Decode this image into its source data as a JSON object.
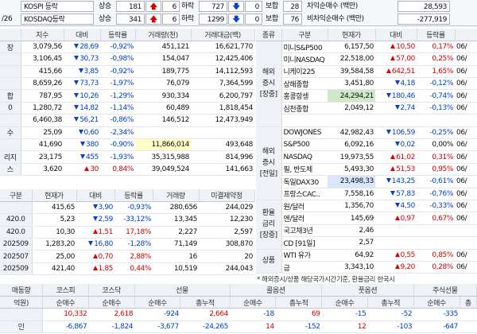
{
  "topbar": {
    "row1": {
      "date": "",
      "market": "KOSPI 등락",
      "rise_label": "상승",
      "rise_val": "181",
      "rise_chg": "6",
      "fall_label": "하락",
      "fall_val": "727",
      "fall_chg": "0",
      "flat_label": "보합",
      "flat_val": "28",
      "right_label": "차익순매수 (백만)",
      "right_val": "28,593"
    },
    "row2": {
      "date": "/26",
      "market": "KOSDAQ등락",
      "rise_label": "상승",
      "rise_val": "341",
      "rise_chg": "6",
      "fall_label": "하락",
      "fall_val": "1299",
      "fall_chg": "0",
      "flat_label": "보합",
      "flat_val": "76",
      "right_label": "비차익순매수 (백만)",
      "right_val": "-277,919"
    }
  },
  "left_table": {
    "headers": [
      "",
      "지수",
      "대비",
      "등락률",
      "거래량(천)",
      "거래대금(백)"
    ],
    "rows": [
      {
        "name": "장",
        "idx": "3,079,56",
        "dir": "dn",
        "chg": "28,69",
        "rate": "-0,92%",
        "vol": "451,121",
        "amt": "16,621,770"
      },
      {
        "name": "",
        "idx": "3,106,45",
        "dir": "dn",
        "chg": "30,73",
        "rate": "-0,98%",
        "vol": "154,047",
        "amt": "12,425,406"
      },
      {
        "name": "",
        "idx": "415,66",
        "dir": "dn",
        "chg": "3,85",
        "rate": "-0,92%",
        "vol": "189,775",
        "amt": "14,112,593"
      },
      {
        "name": "",
        "idx": "8,659,26",
        "dir": "dn",
        "chg": "73,73",
        "rate": "-1,97%",
        "vol": "76,079",
        "amt": "7,364,599"
      },
      {
        "name": "합",
        "idx": "787,95",
        "dir": "dn",
        "chg": "10,26",
        "rate": "-1,29%",
        "vol": "930,334",
        "amt": "6,200,797"
      },
      {
        "name": "0",
        "idx": "1,280,72",
        "dir": "dn",
        "chg": "14,82",
        "rate": "-1,14%",
        "vol": "60,489",
        "amt": "1,818,454"
      },
      {
        "name": "",
        "idx": "6,460,38",
        "dir": "dn",
        "chg": "56,21",
        "rate": "-0,86%",
        "vol": "146,512",
        "amt": "12,473,949"
      },
      {
        "name": "수",
        "idx": "25,09",
        "dir": "dn",
        "chg": "0,60",
        "rate": "-2,34%",
        "vol": "",
        "amt": ""
      },
      {
        "name": "",
        "idx": "41,690",
        "dir": "dn",
        "chg": "380",
        "rate": "-0,90%",
        "vol": "11,866,014",
        "amt": "493,648",
        "vol_hl": "y"
      },
      {
        "name": "리지",
        "idx": "23,175",
        "dir": "dn",
        "chg": "455",
        "rate": "-1,93%",
        "vol": "35,315,988",
        "amt": "814,996"
      },
      {
        "name": "스",
        "idx": "3,620",
        "dir": "up",
        "chg": "30",
        "rate": "0,84%",
        "vol": "39,049,524",
        "amt": "141,663"
      }
    ]
  },
  "futures_table": {
    "headers": [
      "구분",
      "현재가",
      "대비",
      "등락률",
      "거래량",
      "미결제약정"
    ],
    "rows": [
      {
        "name": "",
        "price": "415,65",
        "dir": "dn",
        "chg": "3,90",
        "rate": "-0,93%",
        "vol": "280,656",
        "oi": "244,029"
      },
      {
        "name": "420.0",
        "price": "5,23",
        "dir": "dn",
        "chg": "2,59",
        "rate": "-33,12%",
        "vol": "13,345",
        "oi": "12,230"
      },
      {
        "name": "420.0",
        "price": "10,30",
        "dir": "up",
        "chg": "1,51",
        "rate": "17,18%",
        "vol": "2,227",
        "oi": "2,597"
      },
      {
        "name": "202509",
        "price": "1,283,20",
        "dir": "dn",
        "chg": "16,80",
        "rate": "-1,28%",
        "vol": "71,149",
        "oi": "308,870"
      },
      {
        "name": "202507",
        "price": "25,00",
        "dir": "up",
        "chg": "0,70",
        "rate": "2,88%",
        "vol": "16",
        "oi": "20"
      },
      {
        "name": "202509",
        "price": "421,40",
        "dir": "up",
        "chg": "1,85",
        "rate": "0,44%",
        "vol": "10,519",
        "oi": "244,043"
      }
    ]
  },
  "right_table": {
    "headers": [
      "종류",
      "구분",
      "현재가",
      "대비",
      "등락률",
      ""
    ],
    "groups": [
      {
        "label": "해외\n증시\n[장중]",
        "span": 7
      },
      {
        "label": "해외\n증시\n[전일]",
        "span": 6
      },
      {
        "label": "환율\n금리\n[장중]",
        "span": 4
      },
      {
        "label": "상품",
        "span": 2
      }
    ],
    "rows": [
      {
        "name": "미니S&P500",
        "price": "6,157,50",
        "dir": "up",
        "chg": "10,50",
        "rate": "0,17%",
        "date": "06/"
      },
      {
        "name": "미니NASDAQ",
        "price": "22,518,00",
        "dir": "up",
        "chg": "57,00",
        "rate": "0,25%",
        "date": "06/"
      },
      {
        "name": "니케이225",
        "price": "39,584,58",
        "dir": "up",
        "chg": "642,51",
        "rate": "1,65%",
        "date": "06/"
      },
      {
        "name": "상해종합",
        "price": "3,451,80",
        "dir": "dn",
        "chg": "4,18",
        "rate": "-0,12%",
        "date": "06/"
      },
      {
        "name": "홍콩항셍",
        "price": "24,294,21",
        "dir": "dn",
        "chg": "180,46",
        "rate": "-0,74%",
        "date": "06/",
        "price_hl": "g"
      },
      {
        "name": "심천종합",
        "price": "2,049,12",
        "dir": "dn",
        "chg": "2,74",
        "rate": "-0,13%",
        "date": "06/"
      },
      {
        "name": "",
        "price": "",
        "dir": "",
        "chg": "",
        "rate": "",
        "date": ""
      },
      {
        "name": "DOWJONES",
        "price": "42,982,43",
        "dir": "dn",
        "chg": "106,59",
        "rate": "-0,25%",
        "date": "06/"
      },
      {
        "name": "S&P500",
        "price": "6,092,16",
        "dir": "dn",
        "chg": "0,02",
        "rate": "0,00%",
        "date": "06/"
      },
      {
        "name": "NASDAQ",
        "price": "19,973,55",
        "dir": "up",
        "chg": "61,02",
        "rate": "0,31%",
        "date": "06/"
      },
      {
        "name": "필, 반도체",
        "price": "5,493,30",
        "dir": "up",
        "chg": "51,53",
        "rate": "0,95%",
        "date": "06/"
      },
      {
        "name": "독일DAX30",
        "price": "23,498,33",
        "dir": "dn",
        "chg": "143,25",
        "rate": "-0,61%",
        "date": "06/",
        "price_hl": "b"
      },
      {
        "name": "프랑스CAC..",
        "price": "7,558,16",
        "dir": "dn",
        "chg": "57,83",
        "rate": "-0,76%",
        "date": "06/"
      },
      {
        "name": "원/달러",
        "price": "1,356,70",
        "dir": "dn",
        "chg": "4,50",
        "rate": "-0,33%",
        "date": "06/"
      },
      {
        "name": "엔/달러",
        "price": "145,69",
        "dir": "up",
        "chg": "0,97",
        "rate": "0,67%",
        "date": "06/"
      },
      {
        "name": "국고채3년",
        "price": "2,46",
        "dir": "",
        "chg": "",
        "rate": "",
        "date": ""
      },
      {
        "name": "CD [91일]",
        "price": "2,57",
        "dir": "",
        "chg": "",
        "rate": "",
        "date": ""
      },
      {
        "name": "WTI 유가",
        "price": "64,92",
        "dir": "up",
        "chg": "0,55",
        "rate": "0,85%",
        "date": "06/"
      },
      {
        "name": "금",
        "price": "3,343,10",
        "dir": "up",
        "chg": "9,20",
        "rate": "0,28%",
        "date": "06/"
      }
    ]
  },
  "note": "* 해외증시/상품 해당국가시간기준, 환율금리 한국시",
  "bottom_table": {
    "header1": [
      "매동향",
      "코스피",
      "코스닥",
      "선물",
      "",
      "콜옵션",
      "",
      "풋옵션",
      "",
      "주식선물",
      ""
    ],
    "header2": [
      "억원)",
      "순매수",
      "순매수",
      "순매수",
      "총누적",
      "순매수",
      "총누적",
      "순매수",
      "총누적",
      "순매수",
      "총"
    ],
    "rows": [
      {
        "label": "",
        "vals": [
          "10,332",
          "2,618",
          "-924",
          "2,664",
          "-18",
          "69",
          "-15",
          "-52",
          "-335",
          ""
        ],
        "hl": "y"
      },
      {
        "label": "인",
        "vals": [
          "-6,867",
          "-1,824",
          "-3,677",
          "-24,265",
          "14",
          "-152",
          "12",
          "-103",
          "-647",
          ""
        ],
        "hl": "r"
      }
    ]
  }
}
